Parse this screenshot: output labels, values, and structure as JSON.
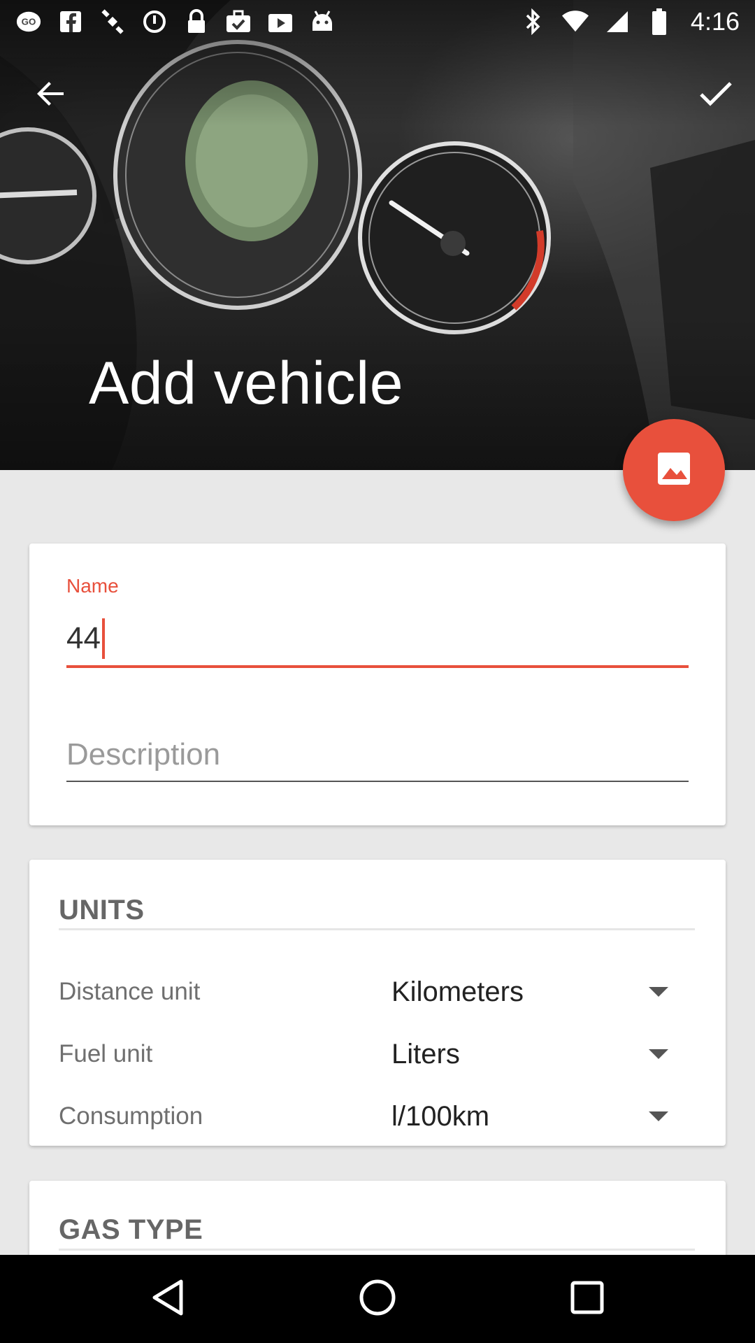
{
  "status_bar": {
    "time": "4:16",
    "left_icons": [
      "go-icon",
      "facebook-icon",
      "satellite-icon",
      "alarm-icon",
      "lock-icon",
      "briefcase-check-icon",
      "play-store-icon",
      "android-icon"
    ],
    "right_icons": [
      "bluetooth-icon",
      "wifi-icon",
      "cell-signal-icon",
      "battery-icon"
    ]
  },
  "app_bar": {
    "title": "Add vehicle",
    "back_icon": "arrow-back-icon",
    "confirm_icon": "check-icon"
  },
  "fab": {
    "icon": "image-icon",
    "color": "#e8503c"
  },
  "form": {
    "name_label": "Name",
    "name_value": "44",
    "description_placeholder": "Description"
  },
  "units": {
    "title": "UNITS",
    "rows": [
      {
        "label": "Distance unit",
        "value": "Kilometers"
      },
      {
        "label": "Fuel unit",
        "value": "Liters"
      },
      {
        "label": "Consumption",
        "value": "l/100km"
      }
    ]
  },
  "gas_type": {
    "title": "GAS TYPE"
  },
  "nav_bar": {
    "icons": [
      "back-triangle-icon",
      "home-circle-icon",
      "recents-square-icon"
    ]
  },
  "colors": {
    "accent": "#e8503c",
    "background": "#e8e8e8",
    "card": "#ffffff"
  }
}
